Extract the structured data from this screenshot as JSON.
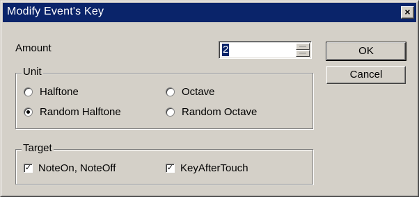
{
  "window": {
    "title": "Modify Event's Key",
    "close_glyph": "×"
  },
  "amount": {
    "label": "Amount",
    "value": "2"
  },
  "buttons": {
    "ok": "OK",
    "cancel": "Cancel"
  },
  "unit": {
    "caption": "Unit",
    "options": [
      {
        "label": "Halftone",
        "checked": false
      },
      {
        "label": "Octave",
        "checked": false
      },
      {
        "label": "Random Halftone",
        "checked": true
      },
      {
        "label": "Random Octave",
        "checked": false
      }
    ]
  },
  "target": {
    "caption": "Target",
    "options": [
      {
        "label": "NoteOn, NoteOff",
        "checked": true
      },
      {
        "label": "KeyAfterTouch",
        "checked": true
      }
    ]
  },
  "icons": {
    "check_glyph": "✓"
  },
  "colors": {
    "title_bar": "#0a246a",
    "face": "#d4d0c8"
  }
}
